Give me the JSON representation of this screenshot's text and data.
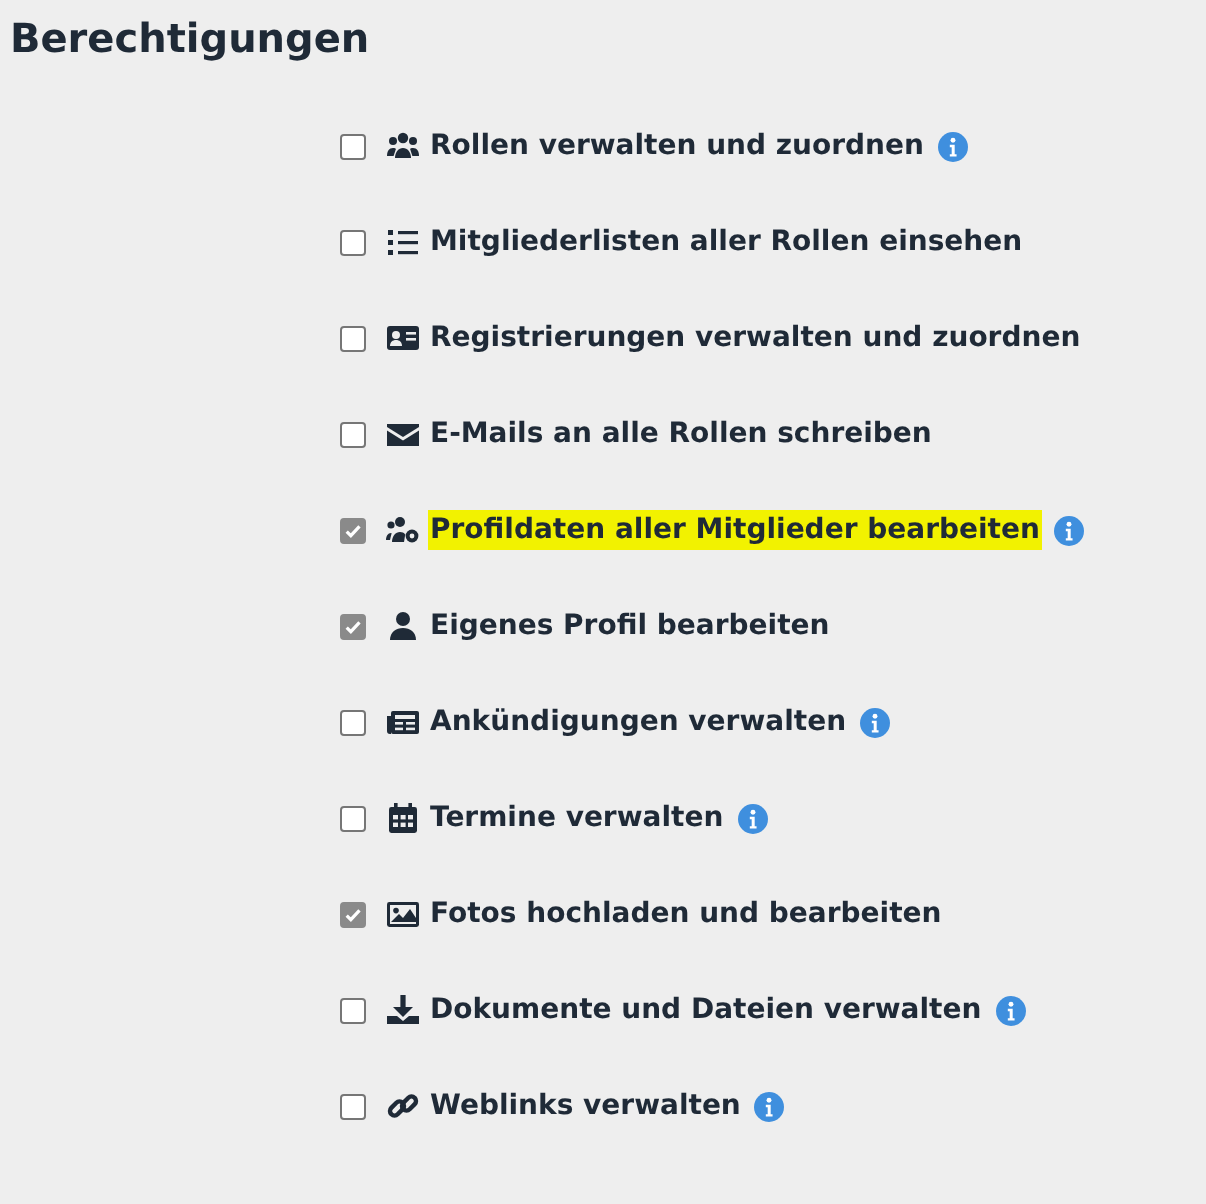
{
  "title": "Berechtigungen",
  "permissions": [
    {
      "label": "Rollen verwalten und zuordnen",
      "checked": false,
      "highlighted": false,
      "info": true
    },
    {
      "label": "Mitgliederlisten aller Rollen einsehen",
      "checked": false,
      "highlighted": false,
      "info": false
    },
    {
      "label": "Registrierungen verwalten und zuordnen",
      "checked": false,
      "highlighted": false,
      "info": false
    },
    {
      "label": "E-Mails an alle Rollen schreiben",
      "checked": false,
      "highlighted": false,
      "info": false
    },
    {
      "label": "Profildaten aller Mitglieder bearbeiten",
      "checked": true,
      "highlighted": true,
      "info": true
    },
    {
      "label": "Eigenes Profil bearbeiten",
      "checked": true,
      "highlighted": false,
      "info": false
    },
    {
      "label": "Ankündigungen verwalten",
      "checked": false,
      "highlighted": false,
      "info": true
    },
    {
      "label": "Termine verwalten",
      "checked": false,
      "highlighted": false,
      "info": true
    },
    {
      "label": "Fotos hochladen und bearbeiten",
      "checked": true,
      "highlighted": false,
      "info": false
    },
    {
      "label": "Dokumente und Dateien verwalten",
      "checked": false,
      "highlighted": false,
      "info": true
    },
    {
      "label": "Weblinks verwalten",
      "checked": false,
      "highlighted": false,
      "info": true
    }
  ]
}
